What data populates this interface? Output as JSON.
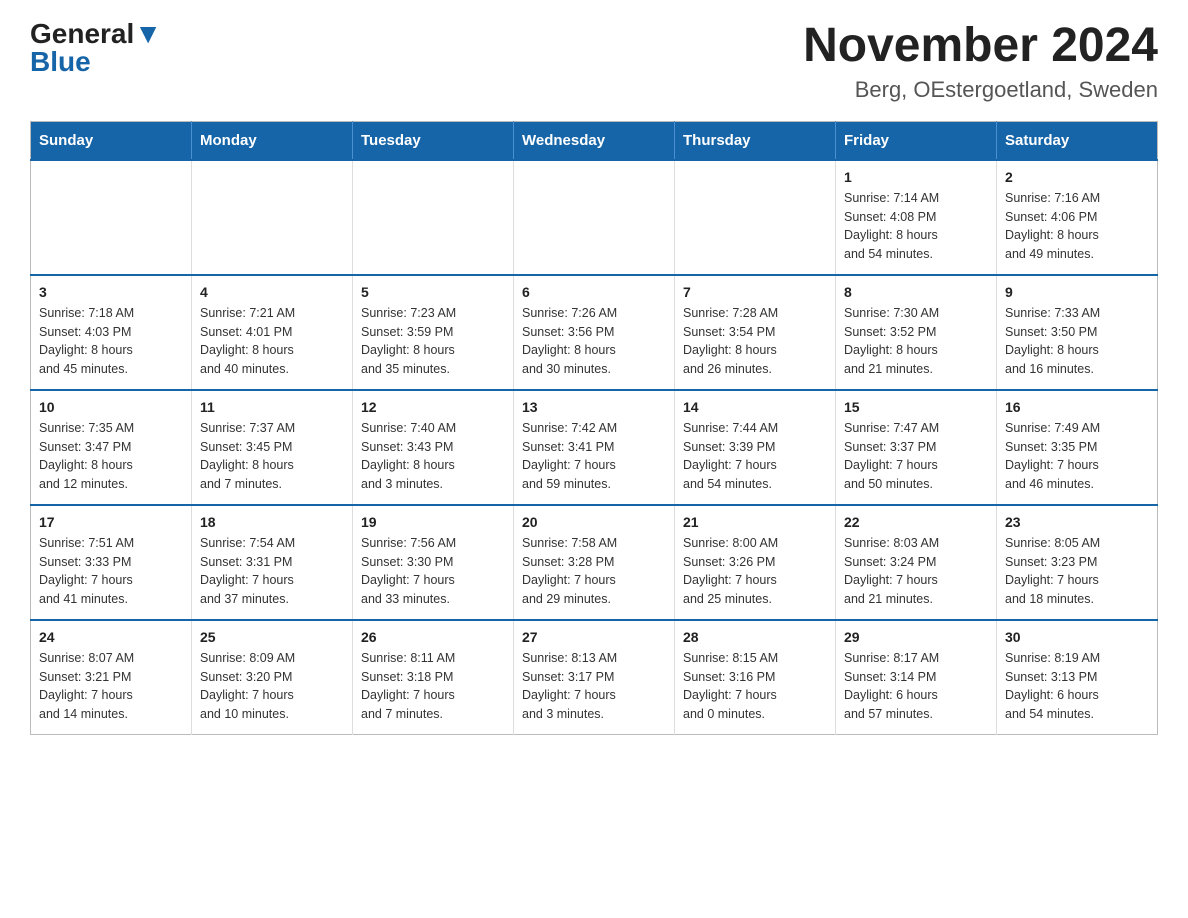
{
  "logo": {
    "general": "General",
    "blue": "Blue"
  },
  "title": "November 2024",
  "subtitle": "Berg, OEstergoetland, Sweden",
  "days_of_week": [
    "Sunday",
    "Monday",
    "Tuesday",
    "Wednesday",
    "Thursday",
    "Friday",
    "Saturday"
  ],
  "weeks": [
    [
      {
        "day": "",
        "info": ""
      },
      {
        "day": "",
        "info": ""
      },
      {
        "day": "",
        "info": ""
      },
      {
        "day": "",
        "info": ""
      },
      {
        "day": "",
        "info": ""
      },
      {
        "day": "1",
        "info": "Sunrise: 7:14 AM\nSunset: 4:08 PM\nDaylight: 8 hours\nand 54 minutes."
      },
      {
        "day": "2",
        "info": "Sunrise: 7:16 AM\nSunset: 4:06 PM\nDaylight: 8 hours\nand 49 minutes."
      }
    ],
    [
      {
        "day": "3",
        "info": "Sunrise: 7:18 AM\nSunset: 4:03 PM\nDaylight: 8 hours\nand 45 minutes."
      },
      {
        "day": "4",
        "info": "Sunrise: 7:21 AM\nSunset: 4:01 PM\nDaylight: 8 hours\nand 40 minutes."
      },
      {
        "day": "5",
        "info": "Sunrise: 7:23 AM\nSunset: 3:59 PM\nDaylight: 8 hours\nand 35 minutes."
      },
      {
        "day": "6",
        "info": "Sunrise: 7:26 AM\nSunset: 3:56 PM\nDaylight: 8 hours\nand 30 minutes."
      },
      {
        "day": "7",
        "info": "Sunrise: 7:28 AM\nSunset: 3:54 PM\nDaylight: 8 hours\nand 26 minutes."
      },
      {
        "day": "8",
        "info": "Sunrise: 7:30 AM\nSunset: 3:52 PM\nDaylight: 8 hours\nand 21 minutes."
      },
      {
        "day": "9",
        "info": "Sunrise: 7:33 AM\nSunset: 3:50 PM\nDaylight: 8 hours\nand 16 minutes."
      }
    ],
    [
      {
        "day": "10",
        "info": "Sunrise: 7:35 AM\nSunset: 3:47 PM\nDaylight: 8 hours\nand 12 minutes."
      },
      {
        "day": "11",
        "info": "Sunrise: 7:37 AM\nSunset: 3:45 PM\nDaylight: 8 hours\nand 7 minutes."
      },
      {
        "day": "12",
        "info": "Sunrise: 7:40 AM\nSunset: 3:43 PM\nDaylight: 8 hours\nand 3 minutes."
      },
      {
        "day": "13",
        "info": "Sunrise: 7:42 AM\nSunset: 3:41 PM\nDaylight: 7 hours\nand 59 minutes."
      },
      {
        "day": "14",
        "info": "Sunrise: 7:44 AM\nSunset: 3:39 PM\nDaylight: 7 hours\nand 54 minutes."
      },
      {
        "day": "15",
        "info": "Sunrise: 7:47 AM\nSunset: 3:37 PM\nDaylight: 7 hours\nand 50 minutes."
      },
      {
        "day": "16",
        "info": "Sunrise: 7:49 AM\nSunset: 3:35 PM\nDaylight: 7 hours\nand 46 minutes."
      }
    ],
    [
      {
        "day": "17",
        "info": "Sunrise: 7:51 AM\nSunset: 3:33 PM\nDaylight: 7 hours\nand 41 minutes."
      },
      {
        "day": "18",
        "info": "Sunrise: 7:54 AM\nSunset: 3:31 PM\nDaylight: 7 hours\nand 37 minutes."
      },
      {
        "day": "19",
        "info": "Sunrise: 7:56 AM\nSunset: 3:30 PM\nDaylight: 7 hours\nand 33 minutes."
      },
      {
        "day": "20",
        "info": "Sunrise: 7:58 AM\nSunset: 3:28 PM\nDaylight: 7 hours\nand 29 minutes."
      },
      {
        "day": "21",
        "info": "Sunrise: 8:00 AM\nSunset: 3:26 PM\nDaylight: 7 hours\nand 25 minutes."
      },
      {
        "day": "22",
        "info": "Sunrise: 8:03 AM\nSunset: 3:24 PM\nDaylight: 7 hours\nand 21 minutes."
      },
      {
        "day": "23",
        "info": "Sunrise: 8:05 AM\nSunset: 3:23 PM\nDaylight: 7 hours\nand 18 minutes."
      }
    ],
    [
      {
        "day": "24",
        "info": "Sunrise: 8:07 AM\nSunset: 3:21 PM\nDaylight: 7 hours\nand 14 minutes."
      },
      {
        "day": "25",
        "info": "Sunrise: 8:09 AM\nSunset: 3:20 PM\nDaylight: 7 hours\nand 10 minutes."
      },
      {
        "day": "26",
        "info": "Sunrise: 8:11 AM\nSunset: 3:18 PM\nDaylight: 7 hours\nand 7 minutes."
      },
      {
        "day": "27",
        "info": "Sunrise: 8:13 AM\nSunset: 3:17 PM\nDaylight: 7 hours\nand 3 minutes."
      },
      {
        "day": "28",
        "info": "Sunrise: 8:15 AM\nSunset: 3:16 PM\nDaylight: 7 hours\nand 0 minutes."
      },
      {
        "day": "29",
        "info": "Sunrise: 8:17 AM\nSunset: 3:14 PM\nDaylight: 6 hours\nand 57 minutes."
      },
      {
        "day": "30",
        "info": "Sunrise: 8:19 AM\nSunset: 3:13 PM\nDaylight: 6 hours\nand 54 minutes."
      }
    ]
  ]
}
